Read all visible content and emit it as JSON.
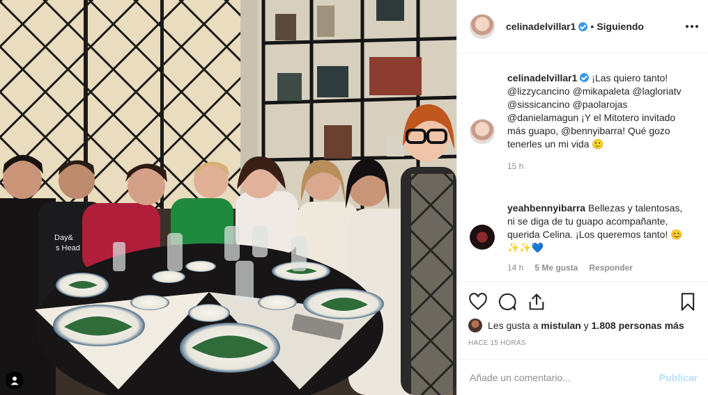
{
  "post": {
    "author": "celinadelvillar1",
    "follow_state": "Siguiendo",
    "separator": "•"
  },
  "caption": {
    "username": "celinadelvillar1",
    "text": "¡Las quiero tanto! @lizzycancino @mikapaleta @lagloriatv @sissicancino @paolarojas @danielamagun ¡Y el Mitotero invitado más guapo, @bennyibarra! Qué gozo tenerles un mi vida 🙂",
    "time": "15 h"
  },
  "comments": [
    {
      "username": "yeahbennyibarra",
      "text": "Bellezas y talentosas, ni se diga de tu guapo acompañante, querida Celina. ¡Los queremos tanto! 😊✨✨💙",
      "time": "14 h",
      "likes_label": "5 Me gusta",
      "reply_label": "Responder"
    }
  ],
  "likes": {
    "prefix": "Les gusta a",
    "user": "mistulan",
    "connector": "y",
    "others": "1.808 personas más"
  },
  "posted_ago": "HACE 15 HORAS",
  "add_comment": {
    "placeholder": "Añade un comentario...",
    "publish_label": "Publicar"
  },
  "icons": {
    "like": "heart-icon",
    "comment": "comment-icon",
    "share": "share-icon",
    "save": "bookmark-icon",
    "more": "more-options-icon",
    "verified": "verified-badge-icon",
    "user_tags": "user-tag-icon"
  },
  "colors": {
    "accent_blue": "#3897f0",
    "publish_disabled": "#b2dffc",
    "muted": "#8e8e8e",
    "text": "#262626"
  }
}
